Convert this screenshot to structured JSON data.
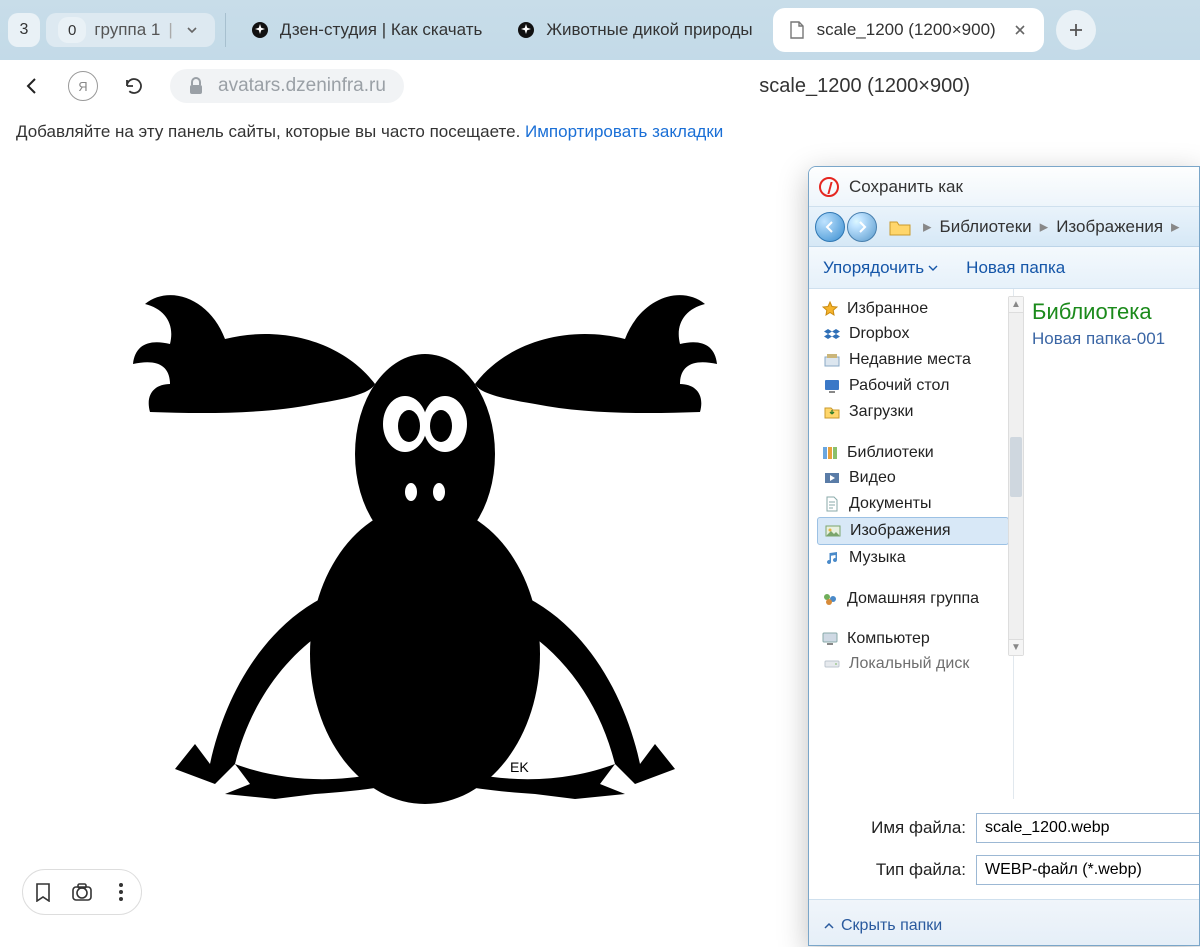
{
  "tabs": {
    "badge1": "3",
    "badge2": "0",
    "group_label": "группа 1",
    "t1": "Дзен-студия | Как скачать",
    "t2": "Животные дикой природы",
    "t3": "scale_1200 (1200×900)"
  },
  "url": {
    "domain": "avatars.dzeninfra.ru",
    "page_title": "scale_1200 (1200×900)"
  },
  "bookmark_hint": {
    "text": "Добавляйте на эту панель сайты, которые вы часто посещаете. ",
    "link": "Импортировать закладки"
  },
  "moose_signature": "EK",
  "dialog": {
    "title": "Сохранить как",
    "crumb1": "Библиотеки",
    "crumb2": "Изображения",
    "toolbar_organize": "Упорядочить",
    "toolbar_newfolder": "Новая папка",
    "fav_header": "Избранное",
    "fav_items": [
      "Dropbox",
      "Недавние места",
      "Рабочий стол",
      "Загрузки"
    ],
    "lib_header": "Библиотеки",
    "lib_items": [
      "Видео",
      "Документы",
      "Изображения",
      "Музыка"
    ],
    "homegroup": "Домашняя группа",
    "computer": "Компьютер",
    "localdisk": "Локальный диск",
    "right_title": "Библиотека",
    "right_sub": "Новая папка-001",
    "filename_label": "Имя файла:",
    "filename_value": "scale_1200.webp",
    "filetype_label": "Тип файла:",
    "filetype_value": "WEBP-файл (*.webp)",
    "hide_folders": "Скрыть папки"
  }
}
